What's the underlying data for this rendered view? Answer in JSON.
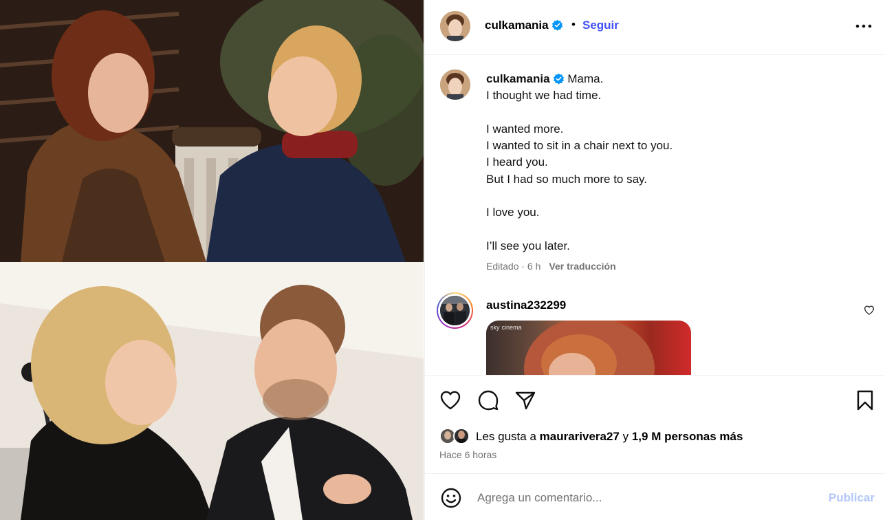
{
  "post": {
    "images": [
      {
        "icon": "still-mother-and-son-photo"
      },
      {
        "icon": "event-mother-and-son-embrace-photo"
      }
    ]
  },
  "header": {
    "username": "culkamania",
    "verified": true,
    "separator": "•",
    "follow_label": "Seguir",
    "more_icon": "more-horizontal-icon"
  },
  "caption": {
    "username": "culkamania",
    "lines": [
      "Mama.",
      "I thought we had time.",
      "",
      "I wanted more.",
      "I wanted to sit in a chair next to you.",
      "I heard you.",
      "But I had so much more to say.",
      "",
      "I love you.",
      "",
      "I’ll see you later."
    ],
    "meta": "Editado · 6 h",
    "translate_label": "Ver traducción"
  },
  "comment": {
    "username": "austina232299",
    "gif_badge_brand": "sky",
    "gif_badge_channel": "cinema"
  },
  "actions": {
    "like_icon": "heart-icon",
    "comment_icon": "comment-icon",
    "share_icon": "share-icon",
    "save_icon": "bookmark-icon"
  },
  "likes": {
    "prefix": "Les gusta a ",
    "user": "maurarivera27",
    "middle": " y ",
    "others": "1,9 M personas más"
  },
  "time_ago": "Hace 6 horas",
  "comment_box": {
    "placeholder": "Agrega un comentario...",
    "publish_label": "Publicar"
  },
  "colors": {
    "link_blue": "#4150f7",
    "publish_disabled": "#b3c7f9",
    "muted": "#737373",
    "verified_blue": "#0095f6",
    "border": "#efefef"
  }
}
